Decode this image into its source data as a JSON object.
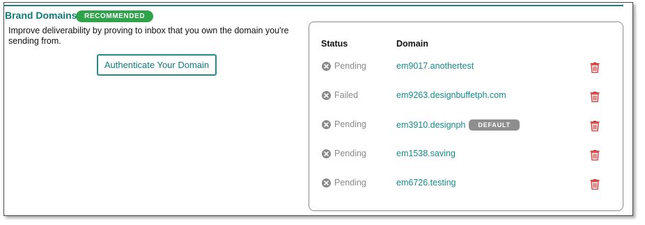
{
  "section": {
    "title": "Brand Domains",
    "badge": "RECOMMENDED",
    "description": "Improve deliverability by proving to inbox that you own the domain you're sending from.",
    "authenticate_button": "Authenticate Your Domain"
  },
  "table": {
    "headers": {
      "status": "Status",
      "domain": "Domain"
    },
    "rows": [
      {
        "status": "Pending",
        "domain": "em9017.anothertest",
        "default_label": ""
      },
      {
        "status": "Failed",
        "domain": "em9263.designbuffetph.com",
        "default_label": ""
      },
      {
        "status": "Pending",
        "domain": "em3910.designph",
        "default_label": "DEFAULT"
      },
      {
        "status": "Pending",
        "domain": "em1538.saving",
        "default_label": ""
      },
      {
        "status": "Pending",
        "domain": "em6726.testing",
        "default_label": ""
      }
    ]
  },
  "icons": {
    "status": "x-circle-icon",
    "delete": "trash-icon"
  },
  "colors": {
    "accent": "#0f7b79",
    "badge_green": "#2ea349",
    "delete_red": "#d32f2f",
    "muted": "#8a8a8a"
  }
}
